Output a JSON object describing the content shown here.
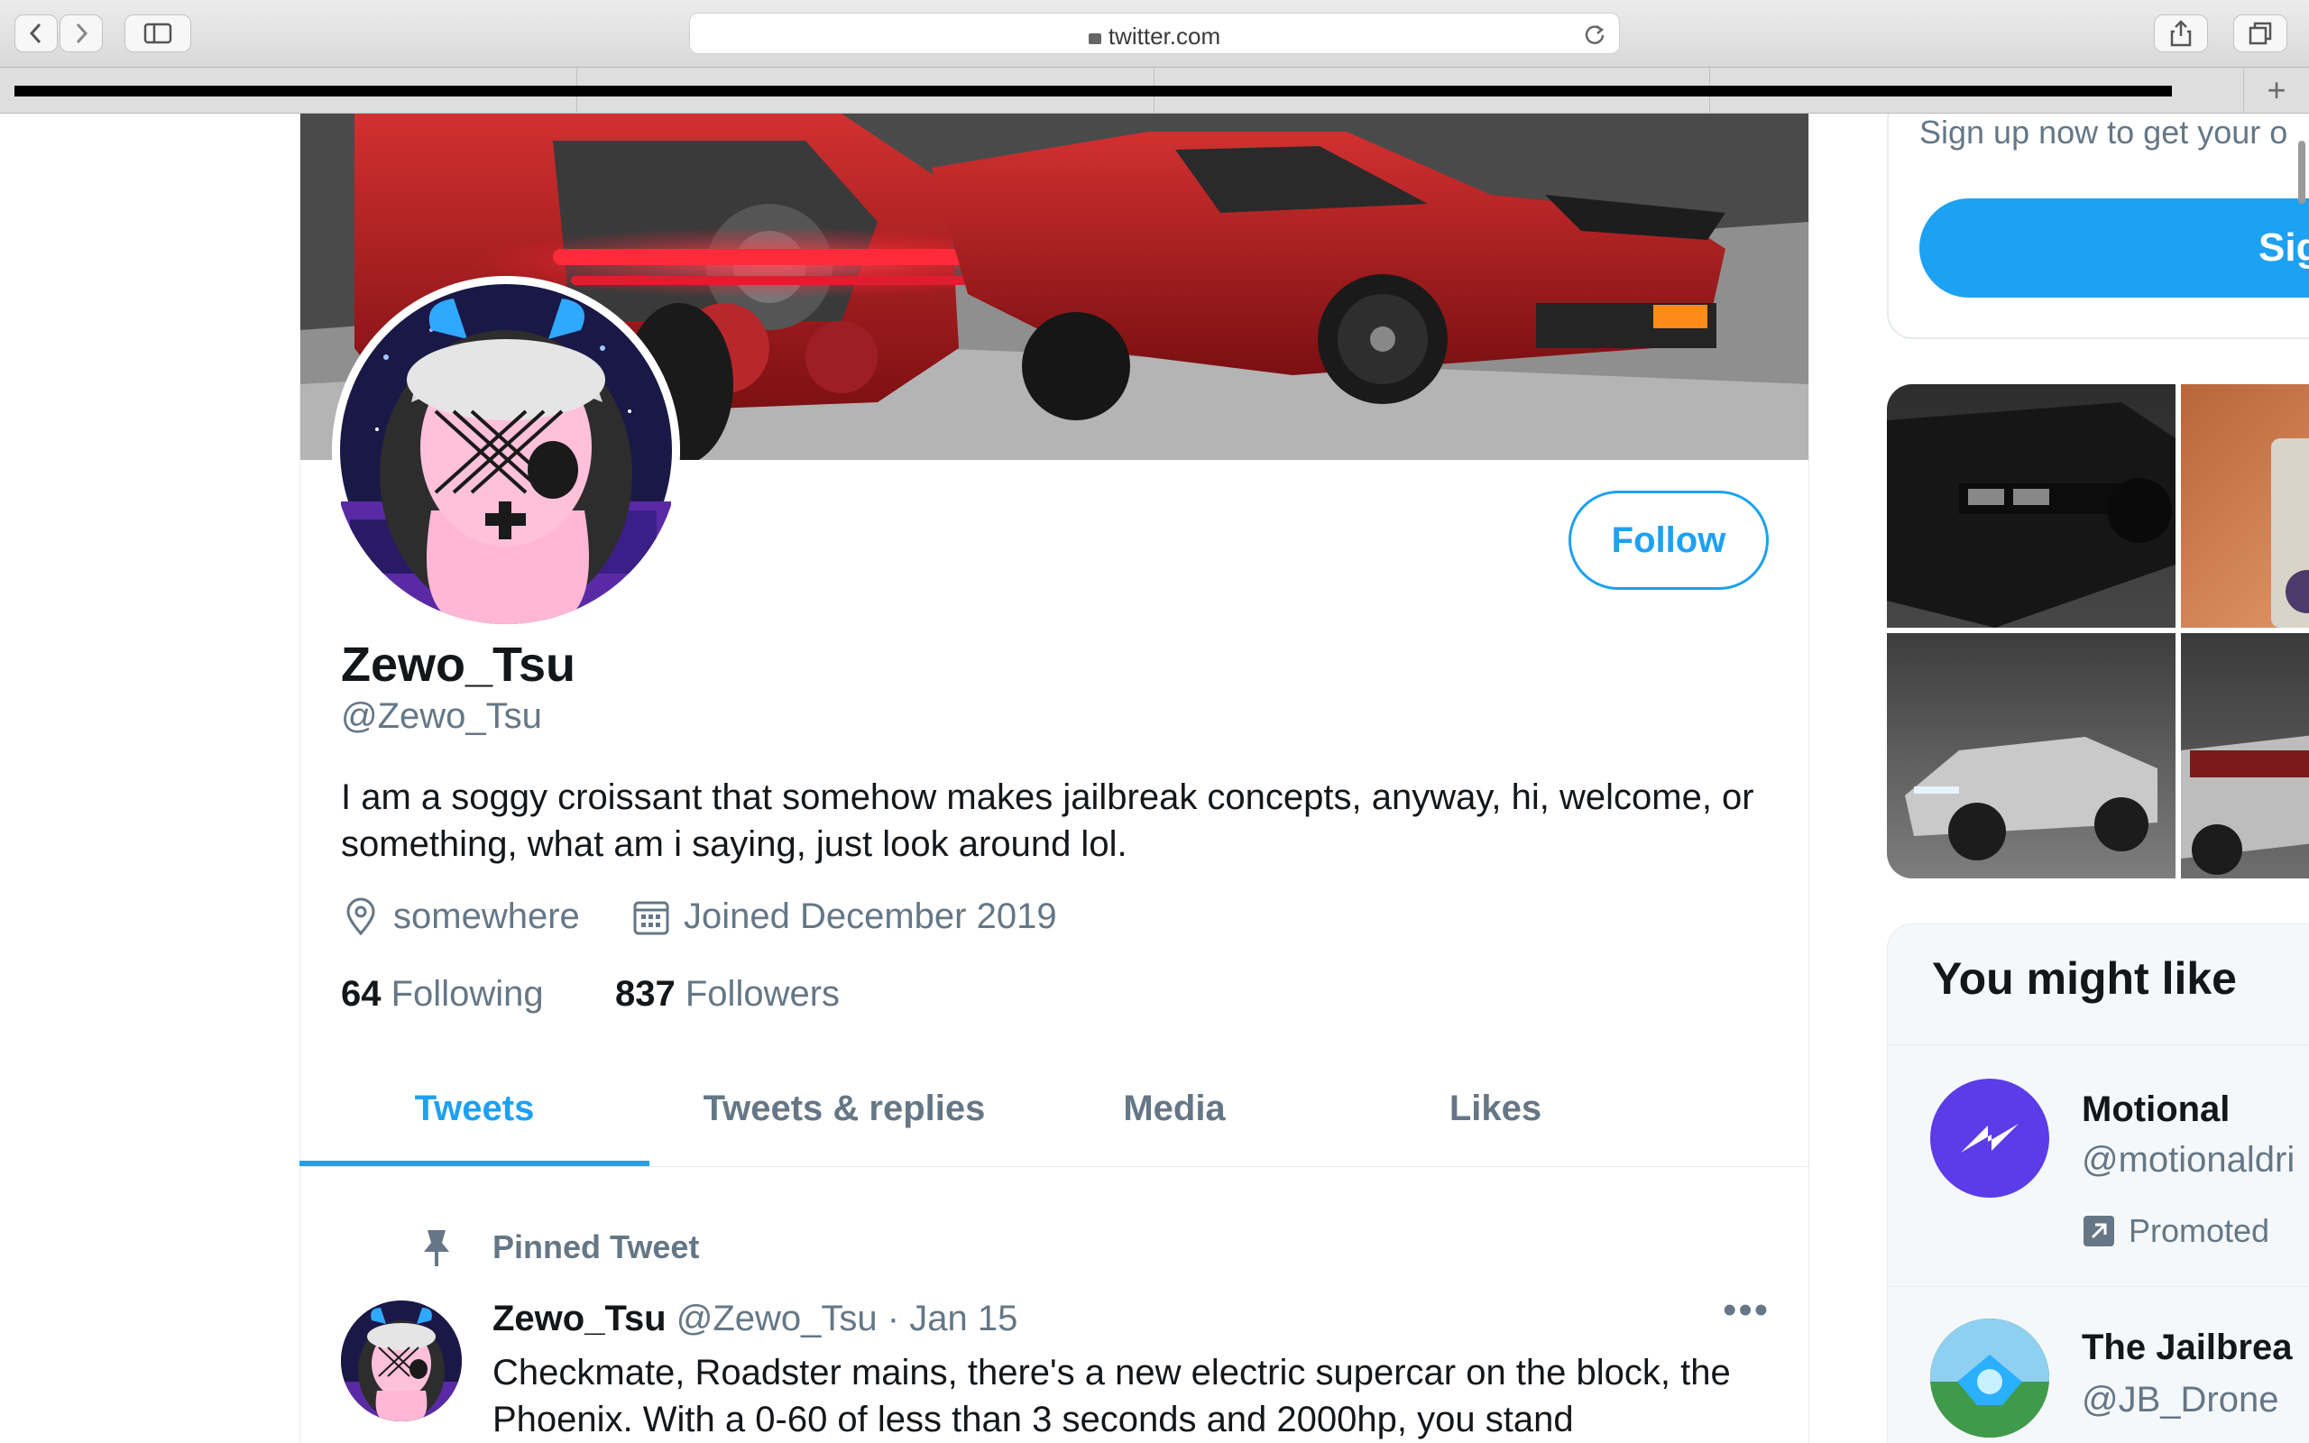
{
  "browser": {
    "url": "twitter.com",
    "tabs": [
      "",
      "",
      "",
      ""
    ],
    "new_tab_symbol": "+"
  },
  "profile": {
    "display_name": "Zewo_Tsu",
    "handle": "@Zewo_Tsu",
    "bio": "I am a soggy croissant that somehow makes jailbreak concepts, anyway, hi, welcome, or something, what am i saying, just look around lol.",
    "location": "somewhere",
    "joined": "Joined December 2019",
    "following_count": "64",
    "following_label": "Following",
    "followers_count": "837",
    "followers_label": "Followers",
    "follow_label": "Follow"
  },
  "tabs": [
    {
      "label": "Tweets",
      "active": true
    },
    {
      "label": "Tweets & replies",
      "active": false
    },
    {
      "label": "Media",
      "active": false
    },
    {
      "label": "Likes",
      "active": false
    }
  ],
  "pinned_tweet": {
    "pinned_label": "Pinned Tweet",
    "author": "Zewo_Tsu",
    "handle": "@Zewo_Tsu",
    "sep": "·",
    "date": "Jan 15",
    "text": "Checkmate, Roadster mains, there's a new electric supercar on the block, the Phoenix. With a 0-60 of less than 3 seconds and 2000hp, you stand"
  },
  "sidebar": {
    "signup_text": "Sign up now to get your o",
    "signup_button": "Sig",
    "you_might_like": "You might like",
    "suggestions": [
      {
        "name": "Motional",
        "handle": "@motionaldri",
        "promoted": "Promoted"
      },
      {
        "name": "The Jailbrea",
        "handle": "@JB_Drone"
      }
    ]
  },
  "colors": {
    "accent": "#1da1f2",
    "secondary_text": "#657786",
    "primary_text": "#14171a"
  }
}
